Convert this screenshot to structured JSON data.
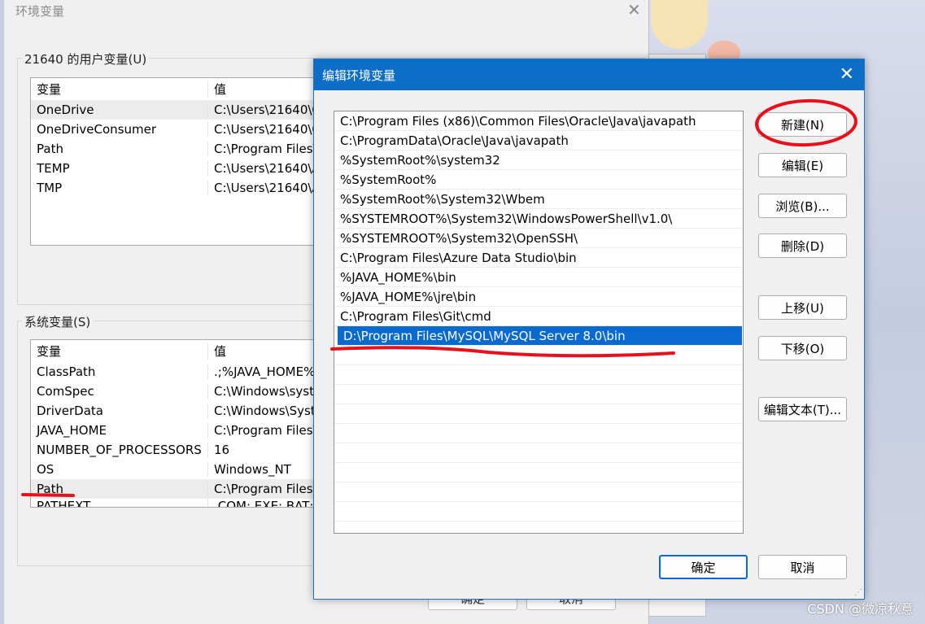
{
  "parent_window": {
    "title": "环境变量",
    "user_group_label": "21640 的用户变量(U)",
    "user_columns": [
      "变量",
      "值"
    ],
    "user_rows": [
      {
        "name": "OneDrive",
        "value": "C:\\Users\\21640\\O"
      },
      {
        "name": "OneDriveConsumer",
        "value": "C:\\Users\\21640\\O"
      },
      {
        "name": "Path",
        "value": "C:\\Program Files\\"
      },
      {
        "name": "TEMP",
        "value": "C:\\Users\\21640\\A"
      },
      {
        "name": "TMP",
        "value": "C:\\Users\\21640\\A"
      }
    ],
    "system_group_label": "系统变量(S)",
    "system_columns": [
      "变量",
      "值"
    ],
    "system_rows": [
      {
        "name": "ClassPath",
        "value": ".;%JAVA_HOME%"
      },
      {
        "name": "ComSpec",
        "value": "C:\\Windows\\syste"
      },
      {
        "name": "DriverData",
        "value": "C:\\Windows\\Syst"
      },
      {
        "name": "JAVA_HOME",
        "value": "C:\\Program Files\\"
      },
      {
        "name": "NUMBER_OF_PROCESSORS",
        "value": "16"
      },
      {
        "name": "OS",
        "value": "Windows_NT"
      },
      {
        "name": "Path",
        "value": "C:\\Program Files"
      },
      {
        "name": "PATHEXT",
        "value": ".COM;.EXE;.BAT;"
      }
    ],
    "bottom_ok": "确定",
    "bottom_cancel": "取消"
  },
  "dialog": {
    "title": "编辑环境变量",
    "paths": [
      "C:\\Program Files (x86)\\Common Files\\Oracle\\Java\\javapath",
      "C:\\ProgramData\\Oracle\\Java\\javapath",
      "%SystemRoot%\\system32",
      "%SystemRoot%",
      "%SystemRoot%\\System32\\Wbem",
      "%SYSTEMROOT%\\System32\\WindowsPowerShell\\v1.0\\",
      "%SYSTEMROOT%\\System32\\OpenSSH\\",
      "C:\\Program Files\\Azure Data Studio\\bin",
      "%JAVA_HOME%\\bin",
      "%JAVA_HOME%\\jre\\bin",
      "C:\\Program Files\\Git\\cmd",
      "D:\\Program Files\\MySQL\\MySQL Server 8.0\\bin"
    ],
    "selected_index": 11,
    "buttons": {
      "new": "新建(N)",
      "edit": "编辑(E)",
      "browse": "浏览(B)...",
      "delete": "删除(D)",
      "move_up": "上移(U)",
      "move_down": "下移(O)",
      "edit_text": "编辑文本(T)...",
      "ok": "确定",
      "cancel": "取消"
    }
  },
  "watermark": "CSDN @微凉秋意",
  "colors": {
    "title_bar": "#0d6ec7",
    "selection": "#0a6ad0",
    "annotation_red": "#e8101a"
  }
}
